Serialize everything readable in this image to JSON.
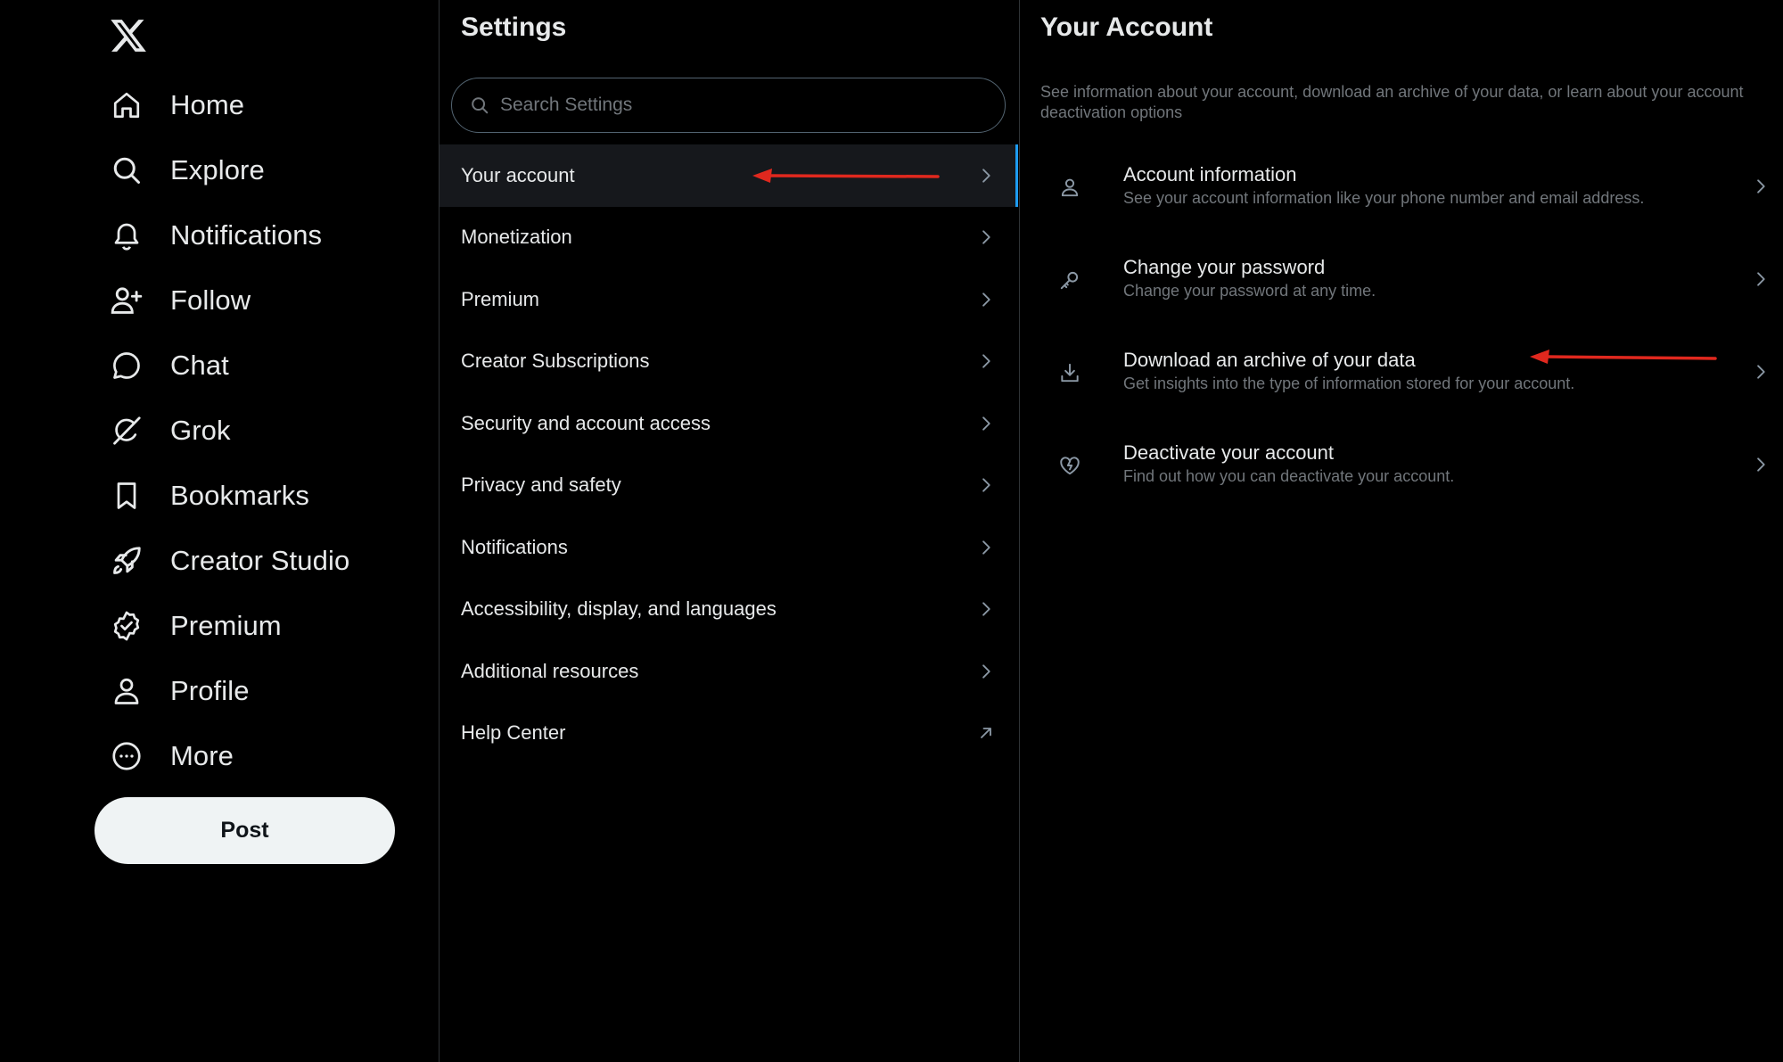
{
  "nav": {
    "logo_icon": "x-logo-icon",
    "items": [
      {
        "label": "Home",
        "icon": "home-icon"
      },
      {
        "label": "Explore",
        "icon": "search-icon"
      },
      {
        "label": "Notifications",
        "icon": "bell-icon"
      },
      {
        "label": "Follow",
        "icon": "person-plus-icon"
      },
      {
        "label": "Chat",
        "icon": "chat-bubble-icon"
      },
      {
        "label": "Grok",
        "icon": "grok-icon"
      },
      {
        "label": "Bookmarks",
        "icon": "bookmark-icon"
      },
      {
        "label": "Creator Studio",
        "icon": "rocket-icon"
      },
      {
        "label": "Premium",
        "icon": "verified-badge-icon"
      },
      {
        "label": "Profile",
        "icon": "person-icon"
      },
      {
        "label": "More",
        "icon": "more-circle-icon"
      }
    ],
    "post_label": "Post"
  },
  "settings": {
    "title": "Settings",
    "search_placeholder": "Search Settings",
    "items": [
      {
        "label": "Your account",
        "active": true
      },
      {
        "label": "Monetization"
      },
      {
        "label": "Premium"
      },
      {
        "label": "Creator Subscriptions"
      },
      {
        "label": "Security and account access"
      },
      {
        "label": "Privacy and safety"
      },
      {
        "label": "Notifications"
      },
      {
        "label": "Accessibility, display, and languages"
      },
      {
        "label": "Additional resources"
      },
      {
        "label": "Help Center",
        "external": true
      }
    ]
  },
  "account": {
    "title": "Your Account",
    "description": "See information about your account, download an archive of your data, or learn about your account deactivation options",
    "items": [
      {
        "title": "Account information",
        "subtitle": "See your account information like your phone number and email address.",
        "icon": "person-icon"
      },
      {
        "title": "Change your password",
        "subtitle": "Change your password at any time.",
        "icon": "key-icon"
      },
      {
        "title": "Download an archive of your data",
        "subtitle": "Get insights into the type of information stored for your account.",
        "icon": "download-icon"
      },
      {
        "title": "Deactivate your account",
        "subtitle": "Find out how you can deactivate your account.",
        "icon": "broken-heart-icon"
      }
    ]
  },
  "colors": {
    "background": "#000000",
    "text_primary": "#e7e9ea",
    "text_secondary": "#71767b",
    "active_indicator": "#1d9bf0",
    "annotation_arrow": "#e0281e"
  }
}
